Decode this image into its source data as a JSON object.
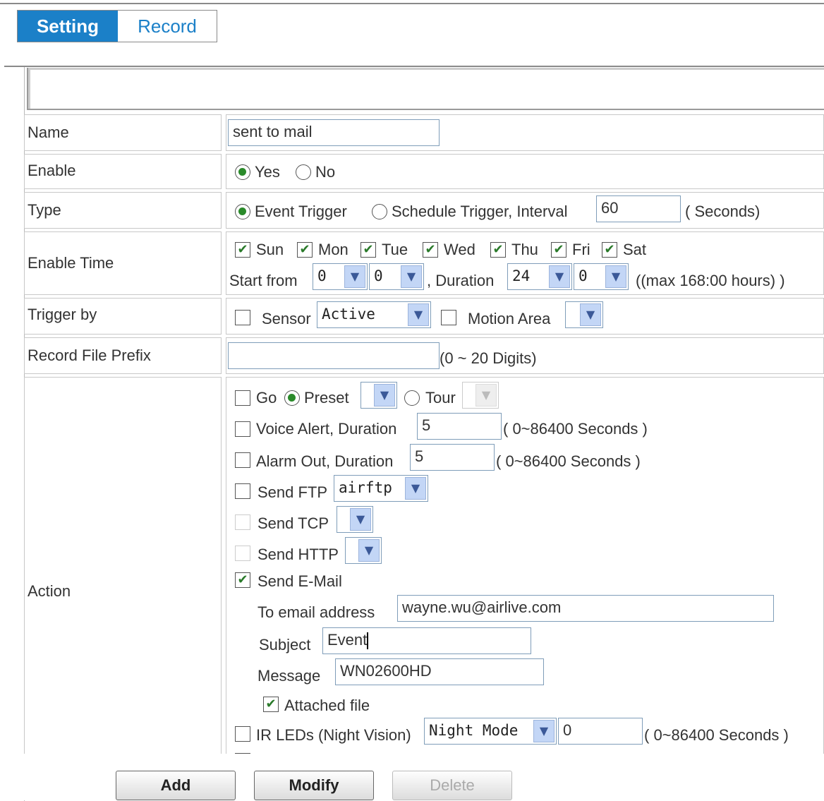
{
  "tabs": {
    "setting": "Setting",
    "record": "Record"
  },
  "rows": {
    "name": {
      "label": "Name",
      "value": "sent to mail"
    },
    "enable": {
      "label": "Enable",
      "yes": "Yes",
      "no": "No"
    },
    "type": {
      "label": "Type",
      "event": "Event Trigger",
      "schedule": "Schedule Trigger, Interval",
      "interval": "60",
      "unit": "( Seconds)"
    },
    "enable_time": {
      "label": "Enable Time",
      "days": [
        "Sun",
        "Mon",
        "Tue",
        "Wed",
        "Thu",
        "Fri",
        "Sat"
      ],
      "start_from": "Start from",
      "start_hour": "0",
      "start_min": "0",
      "duration": ", Duration",
      "dur_hour": "24",
      "dur_min": "0",
      "max": "((max 168:00 hours) )"
    },
    "trigger_by": {
      "label": "Trigger by",
      "sensor": "Sensor",
      "sensor_state": "Active",
      "motion": "Motion Area"
    },
    "prefix": {
      "label": "Record File Prefix",
      "hint": "(0 ~ 20 Digits)"
    },
    "action": {
      "label": "Action",
      "go": "Go",
      "preset": "Preset",
      "tour": "Tour",
      "voice": "Voice Alert, Duration",
      "voice_val": "5",
      "voice_hint": "( 0~86400 Seconds )",
      "alarm": "Alarm Out, Duration",
      "alarm_val": "5",
      "alarm_hint": "( 0~86400 Seconds )",
      "ftp": "Send FTP",
      "ftp_val": "airftp",
      "tcp": "Send TCP",
      "http": "Send HTTP",
      "email": "Send E-Mail",
      "to_label": "To email address",
      "to_val": "wayne.wu@airlive.com",
      "subject_label": "Subject",
      "subject_val": "Event",
      "message_label": "Message",
      "message_val": "WN02600HD",
      "attached": "Attached file",
      "ir": "IR LEDs (Night Vision)",
      "ir_mode": "Night Mode",
      "ir_val": "0",
      "ir_hint": "( 0~86400 Seconds )"
    }
  },
  "buttons": {
    "add": "Add",
    "modify": "Modify",
    "delete": "Delete"
  }
}
